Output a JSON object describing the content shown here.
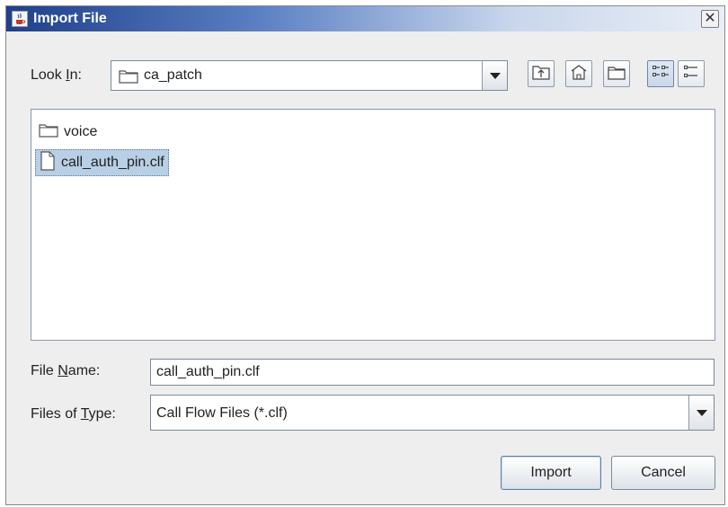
{
  "window": {
    "title": "Import File",
    "close_glyph": "✕"
  },
  "look_in": {
    "label_pre": "Look ",
    "label_mnemonic": "I",
    "label_post": "n:",
    "value": "ca_patch"
  },
  "toolbar": {
    "buttons": [
      {
        "name": "up-one-level-icon"
      },
      {
        "name": "home-icon"
      },
      {
        "name": "new-folder-icon"
      },
      {
        "name": "list-view-icon"
      },
      {
        "name": "details-view-icon"
      }
    ]
  },
  "file_list": {
    "items": [
      {
        "label": "voice",
        "type": "folder",
        "selected": false
      },
      {
        "label": "call_auth_pin.clf",
        "type": "file",
        "selected": true
      }
    ]
  },
  "file_name": {
    "label_pre": "File ",
    "label_mnemonic": "N",
    "label_post": "ame:",
    "value": "call_auth_pin.clf"
  },
  "file_type": {
    "label_pre": "Files of ",
    "label_mnemonic": "T",
    "label_post": "ype:",
    "value": "Call Flow Files (*.clf)"
  },
  "actions": {
    "import_label": "Import",
    "cancel_label": "Cancel"
  }
}
